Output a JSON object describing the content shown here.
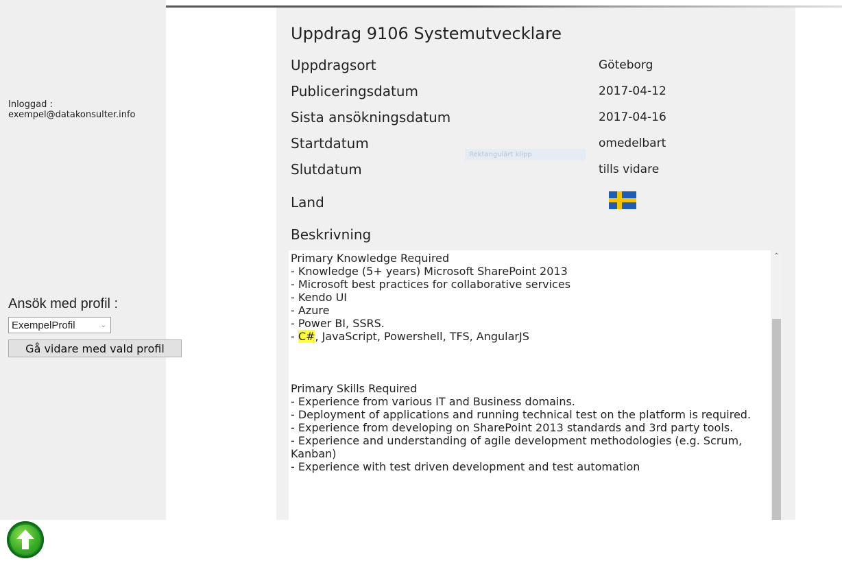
{
  "sidebar": {
    "login_label": "Inloggad :",
    "login_email": "exempel@datakonsulter.info",
    "apply_title": "Ansök med profil :",
    "profile_selected": "ExempelProfil",
    "continue_label": "Gå vidare med vald profil"
  },
  "job": {
    "title": "Uppdrag 9106 Systemutvecklare",
    "fields": {
      "location_label": "Uppdragsort",
      "location_value": "Göteborg",
      "published_label": "Publiceringsdatum",
      "published_value": "2017-04-12",
      "deadline_label": "Sista ansökningsdatum",
      "deadline_value": "2017-04-16",
      "start_label": "Startdatum",
      "start_value": "omedelbart",
      "end_label": "Slutdatum",
      "end_value": "tills vidare",
      "country_label": "Land"
    },
    "country_flag": "sweden-flag",
    "ghost_overlay": "Rektangulärt klipp",
    "description_label": "Beskrivning",
    "description": {
      "line1": "Primary Knowledge Required",
      "line2": "- Knowledge (5+ years) Microsoft SharePoint 2013",
      "line3": "- Microsoft best practices for collaborative services",
      "line4": "- Kendo UI",
      "line5": "- Azure",
      "line6": "- Power BI, SSRS.",
      "line7_prefix": "- ",
      "line7_highlight": "C#",
      "line7_rest": ", JavaScript, Powershell, TFS, AngularJS",
      "skills": "Primary Skills Required\n- Experience from various IT and Business domains.\n- Deployment of applications and running technical test on the platform is required.\n- Experience from developing on SharePoint 2013 standards and 3rd party tools.\n- Experience and understanding of agile development methodologies (e.g. Scrum, Kanban)\n- Experience with test driven development and test automation"
    },
    "highlight_color": "#ffff33"
  },
  "icons": {
    "scroll_up": "chevron-up-icon",
    "back_to_top": "arrow-up-icon",
    "dropdown": "chevron-down-icon"
  }
}
